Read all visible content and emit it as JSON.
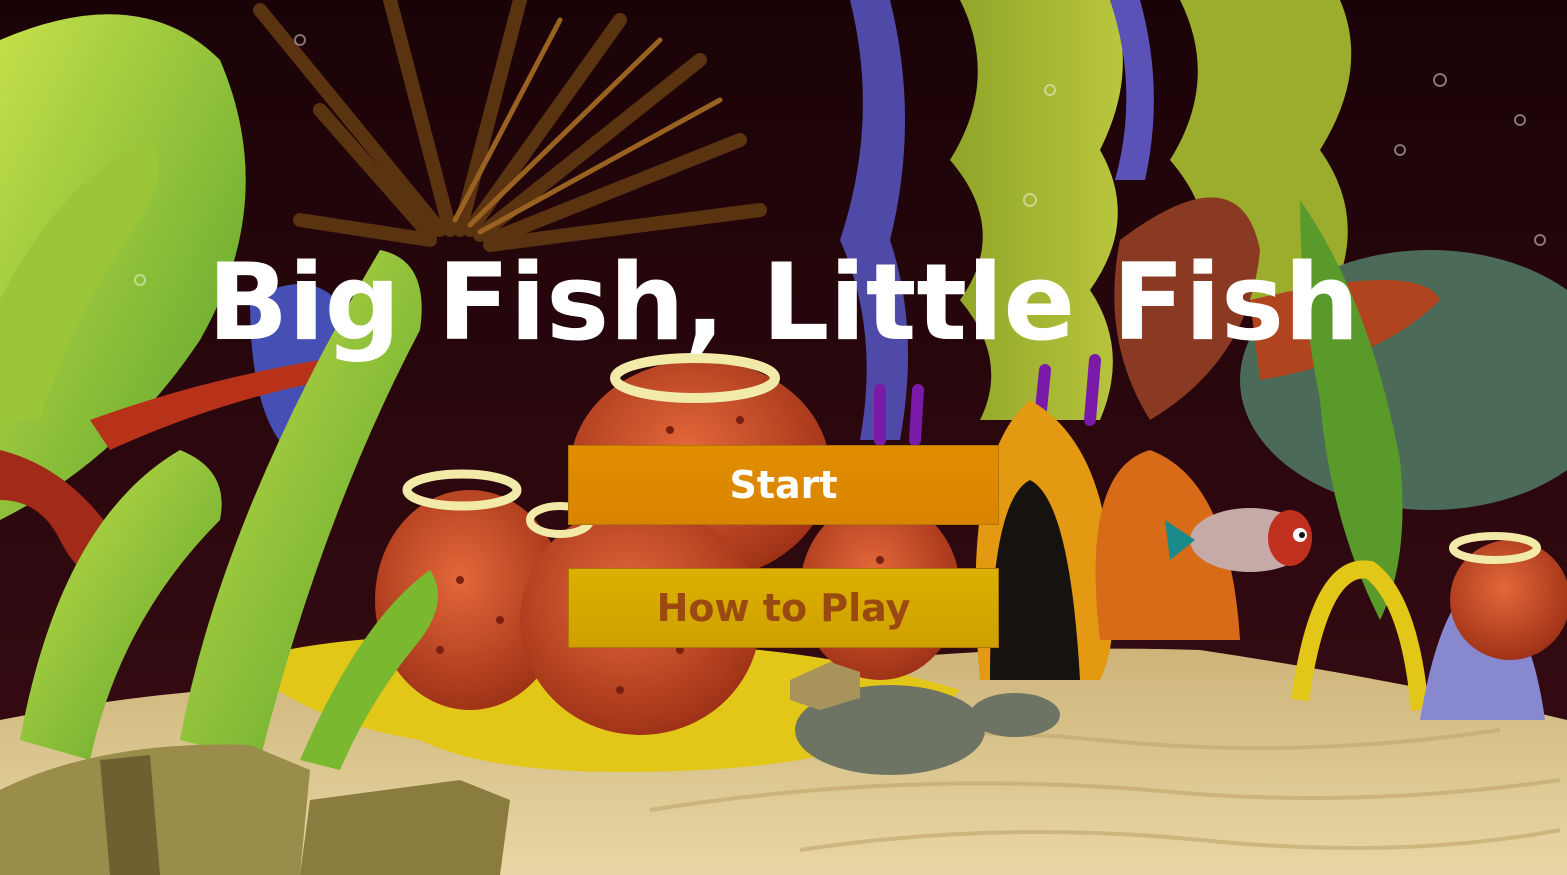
{
  "game": {
    "title": "Big Fish, Little Fish"
  },
  "menu": {
    "start_label": "Start",
    "how_to_play_label": "How to Play"
  },
  "colors": {
    "title_text": "#ffffff",
    "start_button_bg": "#df8a00",
    "start_button_text": "#ffffff",
    "how_to_play_bg": "#d6a800",
    "how_to_play_text": "#9a4a10",
    "background_dark": "#1e0509",
    "sand": "#d8c38c"
  }
}
